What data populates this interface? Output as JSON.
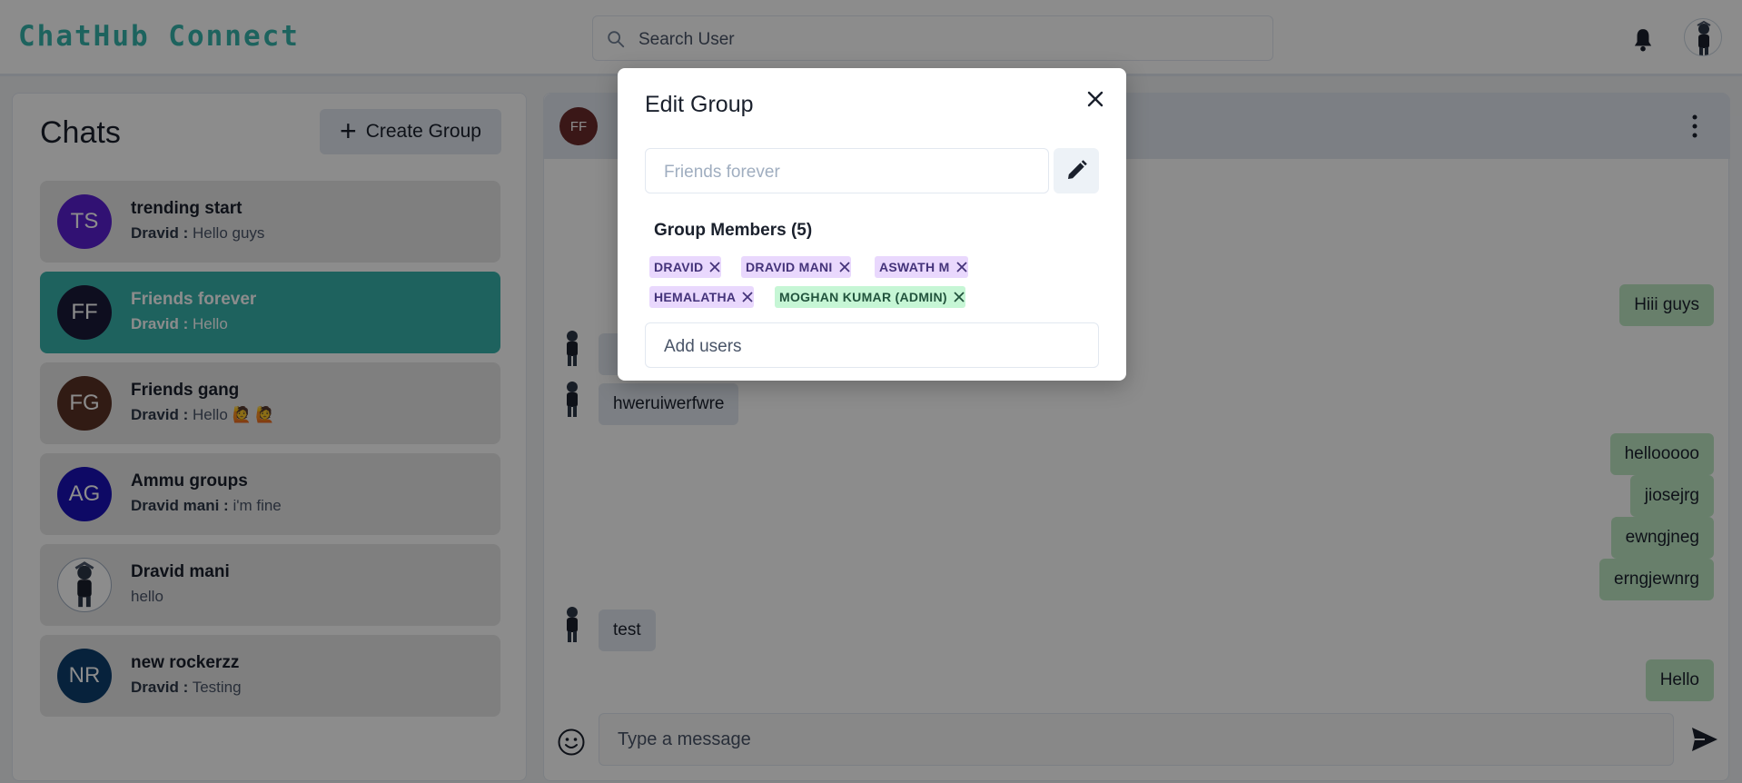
{
  "header": {
    "logo": "ChatHub Connect",
    "search_placeholder": "Search User"
  },
  "sidebar": {
    "title": "Chats",
    "create_group_label": "Create Group",
    "chats": [
      {
        "initials": "TS",
        "name": "trending start",
        "sender": "Dravid :",
        "message": "Hello guys",
        "color": "#5a1fd1"
      },
      {
        "initials": "FF",
        "name": "Friends forever",
        "sender": "Dravid :",
        "message": "Hello",
        "color": "#1a1a3a",
        "active": true
      },
      {
        "initials": "FG",
        "name": "Friends gang",
        "sender": "Dravid :",
        "message": "Hello 🙋 🙋",
        "color": "#5a3226"
      },
      {
        "initials": "AG",
        "name": "Ammu groups",
        "sender": "Dravid mani :",
        "message": "i'm fine",
        "color": "#1a12b8"
      },
      {
        "initials": "",
        "name": "Dravid mani",
        "sender": "",
        "message": "hello",
        "color": "#ffffff"
      },
      {
        "initials": "NR",
        "name": "new rockerzz",
        "sender": "Dravid :",
        "message": "Testing",
        "color": "#0d3e6e"
      }
    ]
  },
  "conversation": {
    "header_initials": "FF",
    "input_placeholder": "Type a message",
    "messages": [
      {
        "text": "Hiii guys",
        "side": "out"
      },
      {
        "text": "hweruiwerfwre",
        "side": "in"
      },
      {
        "text": "hellooooo",
        "side": "out"
      },
      {
        "text": "jiosejrg",
        "side": "out"
      },
      {
        "text": "ewngjneg",
        "side": "out"
      },
      {
        "text": "erngjewnrg",
        "side": "out"
      },
      {
        "text": "test",
        "side": "in"
      },
      {
        "text": "Hello",
        "side": "out"
      }
    ]
  },
  "modal": {
    "title": "Edit Group",
    "group_name_placeholder": "Friends forever",
    "members_heading": "Group Members (5)",
    "members": [
      {
        "label": "DRAVID",
        "kind": "purple"
      },
      {
        "label": "DRAVID MANI",
        "kind": "purple"
      },
      {
        "label": "ASWATH M",
        "kind": "purple"
      },
      {
        "label": "HEMALATHA",
        "kind": "purple"
      },
      {
        "label": "MOGHAN KUMAR (ADMIN)",
        "kind": "green"
      }
    ],
    "add_users_placeholder": "Add users"
  },
  "colors": {
    "accent": "#38b2ac",
    "logo": "#35b5ab",
    "outgoing_bubble": "#bde8c4",
    "incoming_bubble": "#e2e8f0"
  },
  "icons": [
    "search-icon",
    "bell-icon",
    "plus-icon",
    "kebab-menu-icon",
    "emoji-icon",
    "send-icon",
    "close-icon",
    "pencil-icon"
  ]
}
